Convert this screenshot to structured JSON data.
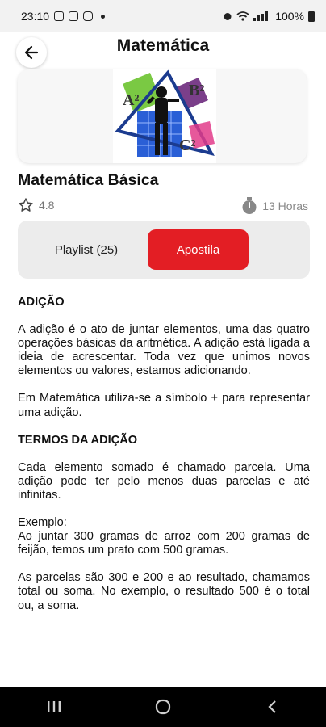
{
  "status_bar": {
    "time": "23:10",
    "battery": "100%"
  },
  "header": {
    "title": "Matemática"
  },
  "course": {
    "title": "Matemática Básica",
    "rating": "4.8",
    "duration": "13 Horas"
  },
  "tabs": {
    "playlist": "Playlist (25)",
    "apostila": "Apostila"
  },
  "hero_labels": {
    "a2": "A²",
    "b2": "B²",
    "c2": "C²"
  },
  "content": {
    "h1": "ADIÇÃO",
    "p1": "A adição é o ato de juntar elementos, uma das quatro operações básicas da aritmética. A adição está ligada a ideia de acrescentar. Toda vez que unimos novos elementos ou valores, estamos adicionando.",
    "p2": "Em Matemática utiliza-se a símbolo + para representar uma adição.",
    "h2": "TERMOS DA ADIÇÃO",
    "p3": "Cada elemento somado é chamado parcela. Uma adição pode ter pelo menos duas parcelas e até infinitas.",
    "p4_label": "Exemplo:",
    "p4": "Ao juntar 300 gramas de arroz com 200 gramas de feijão, temos um prato com 500 gramas.",
    "p5": "As parcelas são 300 e 200 e ao resultado, chamamos total ou soma. No exemplo, o resultado 500 é o total ou, a soma."
  },
  "colors": {
    "accent": "#e31e24",
    "tab_bg": "#ececec"
  },
  "icons": {
    "back": "arrow-left-icon",
    "star": "star-icon",
    "timer": "stopwatch-icon"
  }
}
